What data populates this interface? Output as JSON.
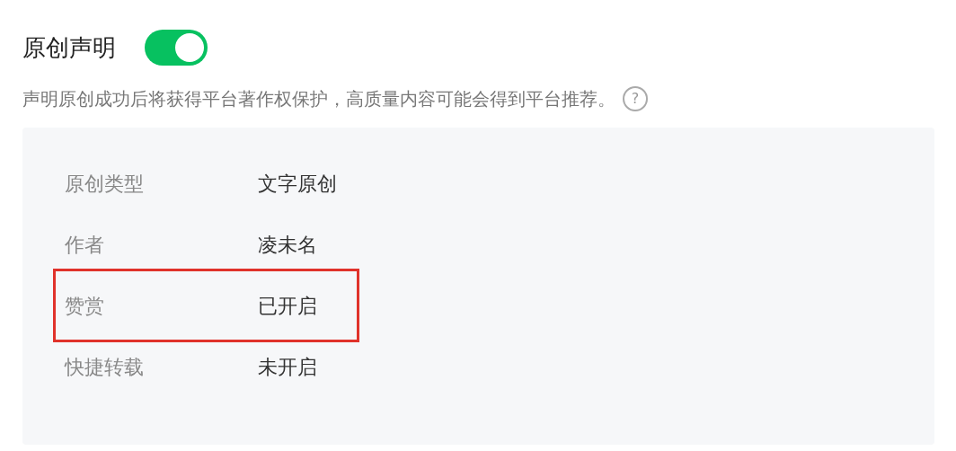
{
  "header": {
    "title": "原创声明",
    "toggle": {
      "on": true
    }
  },
  "description": "声明原创成功后将获得平台著作权保护，高质量内容可能会得到平台推荐。",
  "help_icon": "?",
  "rows": [
    {
      "label": "原创类型",
      "value": "文字原创",
      "highlighted": false
    },
    {
      "label": "作者",
      "value": "凌未名",
      "highlighted": false
    },
    {
      "label": "赞赏",
      "value": "已开启",
      "highlighted": true
    },
    {
      "label": "快捷转载",
      "value": "未开启",
      "highlighted": false
    }
  ]
}
